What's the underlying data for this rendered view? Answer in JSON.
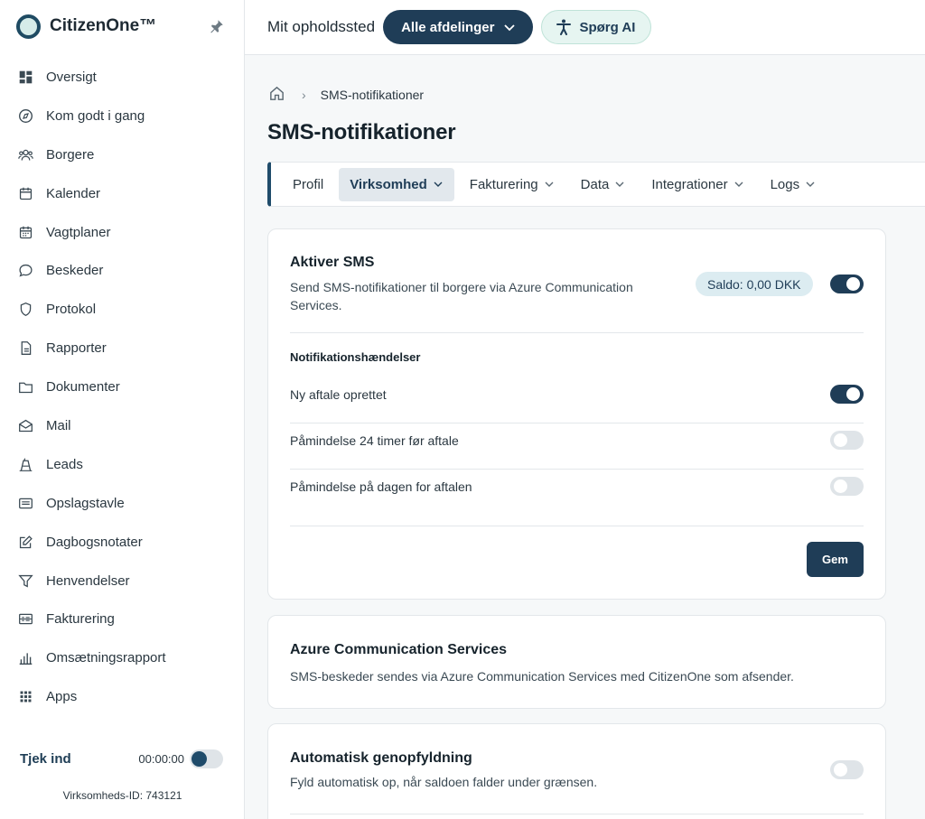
{
  "app": {
    "name": "CitizenOne™"
  },
  "sidebar": {
    "items": [
      {
        "label": "Oversigt",
        "icon": "dashboard-icon"
      },
      {
        "label": "Kom godt i gang",
        "icon": "compass-icon"
      },
      {
        "label": "Borgere",
        "icon": "people-icon"
      },
      {
        "label": "Kalender",
        "icon": "calendar-icon"
      },
      {
        "label": "Vagtplaner",
        "icon": "schedule-icon"
      },
      {
        "label": "Beskeder",
        "icon": "chat-icon"
      },
      {
        "label": "Protokol",
        "icon": "shield-icon"
      },
      {
        "label": "Rapporter",
        "icon": "report-icon"
      },
      {
        "label": "Dokumenter",
        "icon": "folder-icon"
      },
      {
        "label": "Mail",
        "icon": "mail-icon"
      },
      {
        "label": "Leads",
        "icon": "leads-icon"
      },
      {
        "label": "Opslagstavle",
        "icon": "board-icon"
      },
      {
        "label": "Dagbogsnotater",
        "icon": "edit-icon"
      },
      {
        "label": "Henvendelser",
        "icon": "filter-icon"
      },
      {
        "label": "Fakturering",
        "icon": "invoice-icon"
      },
      {
        "label": "Omsætningsrapport",
        "icon": "bar-chart-icon"
      },
      {
        "label": "Apps",
        "icon": "apps-grid-icon"
      }
    ],
    "checkin": {
      "label": "Tjek ind",
      "time": "00:00:00"
    },
    "company_id": "Virksomheds-ID: 743121"
  },
  "topbar": {
    "label": "Mit opholdssted",
    "department": "Alle afdelinger",
    "ai": "Spørg AI"
  },
  "breadcrumb": {
    "current": "SMS-notifikationer"
  },
  "page": {
    "title": "SMS-notifikationer"
  },
  "tabs": [
    {
      "label": "Profil"
    },
    {
      "label": "Virksomhed"
    },
    {
      "label": "Fakturering"
    },
    {
      "label": "Data"
    },
    {
      "label": "Integrationer"
    },
    {
      "label": "Logs"
    }
  ],
  "sms": {
    "title": "Aktiver SMS",
    "desc": "Send SMS-notifikationer til borgere via Azure Communication Services.",
    "balance": "Saldo: 0,00 DKK",
    "enabled": true,
    "events_title": "Notifikationshændelser",
    "events": [
      {
        "label": "Ny aftale oprettet",
        "on": true
      },
      {
        "label": "Påmindelse 24 timer før aftale",
        "on": false
      },
      {
        "label": "Påmindelse på dagen for aftalen",
        "on": false
      }
    ],
    "save": "Gem"
  },
  "azure": {
    "title": "Azure Communication Services",
    "desc": "SMS-beskeder sendes via Azure Communication Services med CitizenOne som afsender."
  },
  "refill": {
    "title": "Automatisk genopfyldning",
    "desc": "Fyld automatisk op, når saldoen falder under grænsen.",
    "enabled": false
  },
  "colors": {
    "primary": "#1f3d57",
    "accent_bg": "#e6f5f1"
  }
}
